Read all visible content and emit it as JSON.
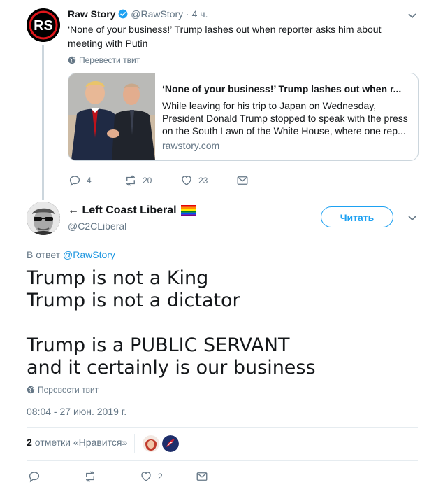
{
  "parent_tweet": {
    "avatar_text": "RS",
    "name": "Raw Story",
    "handle": "@RawStory",
    "time": "· 4 ч.",
    "text": "‘None of your business!’ Trump lashes out when reporter asks him about meeting with Putin",
    "translate": "Перевести твит",
    "card": {
      "title": "‘None of your business!’ Trump lashes out when r...",
      "description": "While leaving for his trip to Japan on Wednesday, President Donald Trump stopped to speak with the press on the South Lawn of the White House, where one rep...",
      "domain": "rawstory.com"
    },
    "actions": {
      "replies": "4",
      "retweets": "20",
      "likes": "23"
    }
  },
  "main_tweet": {
    "name": "← Left Coast Liberal",
    "handle": "@C2CLiberal",
    "follow_label": "Читать",
    "reply_prefix": "В ответ",
    "reply_handle": "@RawStory",
    "lines": [
      "Trump is not a King",
      "Trump is not a dictator",
      "",
      "Trump is a PUBLIC SERVANT",
      "and it certainly is our business"
    ],
    "translate": "Перевести твит",
    "timestamp": "08:04 - 27 июн. 2019 г.",
    "likes_count": "2",
    "likes_label": "отметки «Нравится»",
    "actions": {
      "likes": "2"
    }
  },
  "colors": {
    "accent": "#1da1f2",
    "link": "#1b95e0",
    "muted": "#657786",
    "verified": "#1da1f2"
  },
  "icons": [
    "chevron-down-icon",
    "verified-icon",
    "globe-icon",
    "reply-icon",
    "retweet-icon",
    "like-icon",
    "message-icon",
    "rainbow-flag-icon"
  ]
}
